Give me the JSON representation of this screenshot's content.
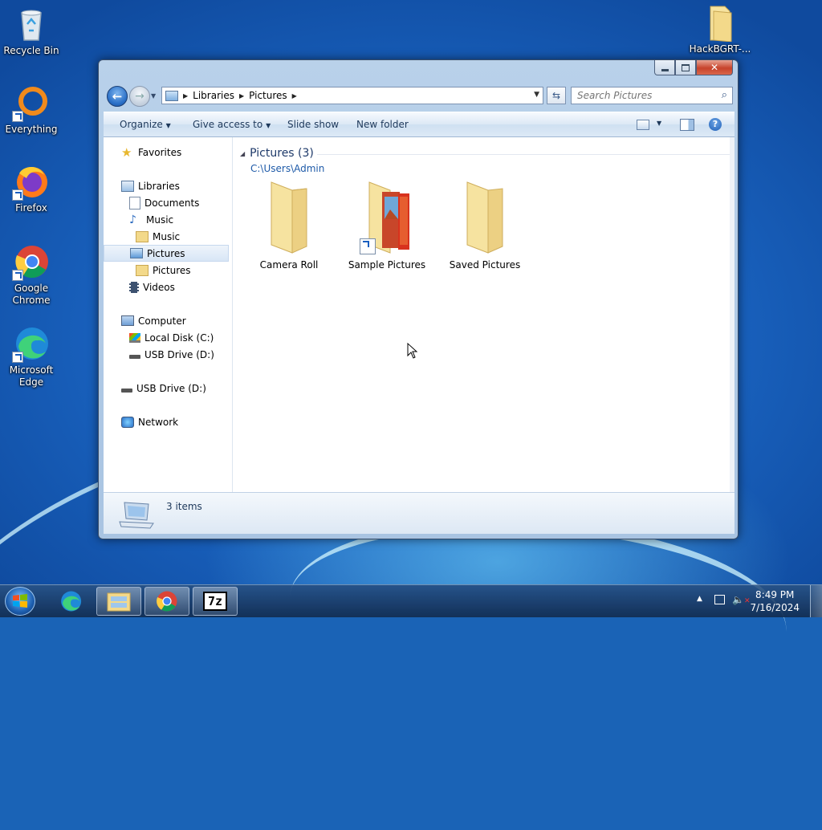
{
  "desktop": {
    "icons": [
      {
        "label": "Recycle Bin"
      },
      {
        "label": "Everything"
      },
      {
        "label": "Firefox"
      },
      {
        "label": "Google Chrome"
      },
      {
        "label": "Microsoft Edge"
      },
      {
        "label": "HackBGRT-..."
      }
    ]
  },
  "window": {
    "address": {
      "crumbs": [
        "Libraries",
        "Pictures"
      ]
    },
    "search": {
      "placeholder": "Search Pictures"
    },
    "toolbar": {
      "organize": "Organize",
      "give_access": "Give access to",
      "slide_show": "Slide show",
      "new_folder": "New folder"
    },
    "nav": {
      "favorites": "Favorites",
      "libraries": "Libraries",
      "documents": "Documents",
      "music": "Music",
      "music_sub": "Music",
      "pictures": "Pictures",
      "pictures_sub": "Pictures",
      "videos": "Videos",
      "computer": "Computer",
      "local_disk": "Local Disk (C:)",
      "usb_sub": "USB Drive (D:)",
      "usb": "USB Drive (D:)",
      "network": "Network"
    },
    "main": {
      "group_title": "Pictures (3)",
      "group_path": "C:\\Users\\Admin",
      "folders": [
        {
          "label": "Camera Roll"
        },
        {
          "label": "Sample Pictures"
        },
        {
          "label": "Saved Pictures"
        }
      ]
    },
    "status": {
      "items": "3 items"
    }
  },
  "taskbar": {
    "time": "8:49 PM",
    "date": "7/16/2024"
  },
  "colors": {
    "accent_link": "#1e5aa8",
    "folder": "#f3d98a",
    "selection": "#d8e6f6"
  }
}
